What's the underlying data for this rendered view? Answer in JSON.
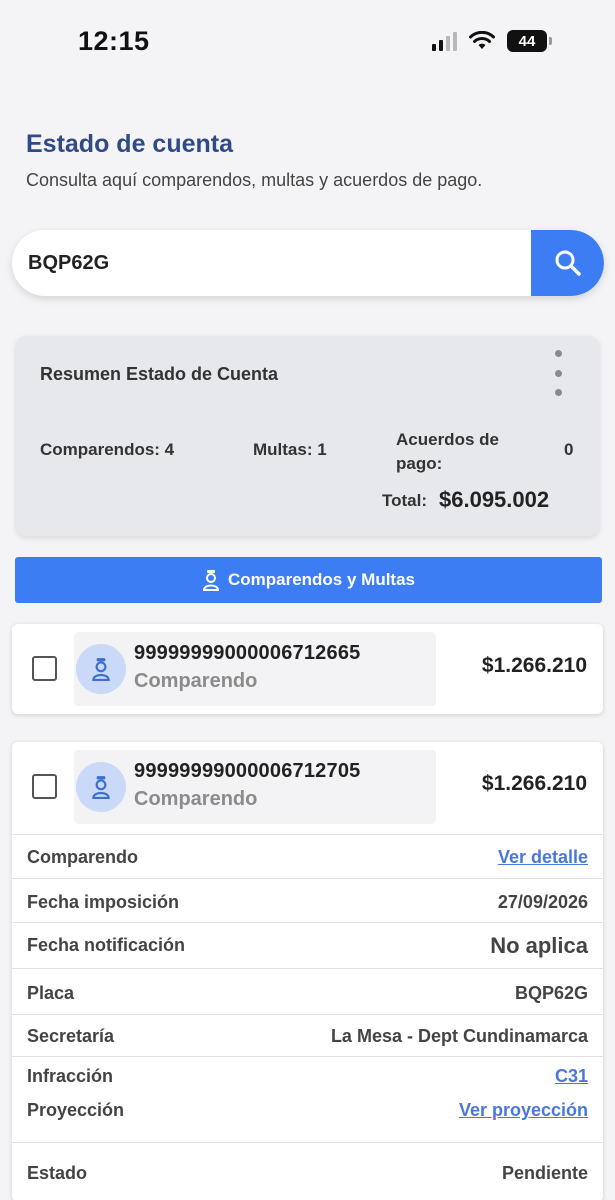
{
  "status_bar": {
    "time": "12:15",
    "battery": "44"
  },
  "header": {
    "title": "Estado de cuenta",
    "subtitle": "Consulta aquí comparendos, multas y acuerdos de pago."
  },
  "search": {
    "value": "BQP62G",
    "icon": "search-icon"
  },
  "summary": {
    "title": "Resumen Estado de Cuenta",
    "comparendos": "Comparendos: 4",
    "multas": "Multas: 1",
    "acuerdos_label": "Acuerdos de pago:",
    "acuerdos_value": "0",
    "total_label": "Total:",
    "total_value": "$6.095.002"
  },
  "tab": {
    "label": "Comparendos y Multas",
    "icon": "person-badge-icon"
  },
  "items": [
    {
      "number": "99999999000006712665",
      "type": "Comparendo",
      "amount": "$1.266.210"
    },
    {
      "number": "99999999000006712705",
      "type": "Comparendo",
      "amount": "$1.266.210",
      "details": [
        {
          "label": "Comparendo",
          "value": "Ver detalle"
        },
        {
          "label": "Fecha imposición",
          "value": "27/09/2026"
        },
        {
          "label": "Fecha notificación",
          "value": "No aplica"
        },
        {
          "label": "Placa",
          "value": "BQP62G"
        },
        {
          "label": "Secretaría",
          "value": "La Mesa - Dept Cundinamarca"
        },
        {
          "label": "Infracción",
          "value": "C31"
        },
        {
          "label": "Proyección",
          "value": "Ver proyección"
        },
        {
          "label": "Estado",
          "value": "Pendiente"
        }
      ]
    }
  ],
  "colors": {
    "accent": "#3d7df3",
    "title": "#2f4a86",
    "link": "#4a78d8"
  }
}
